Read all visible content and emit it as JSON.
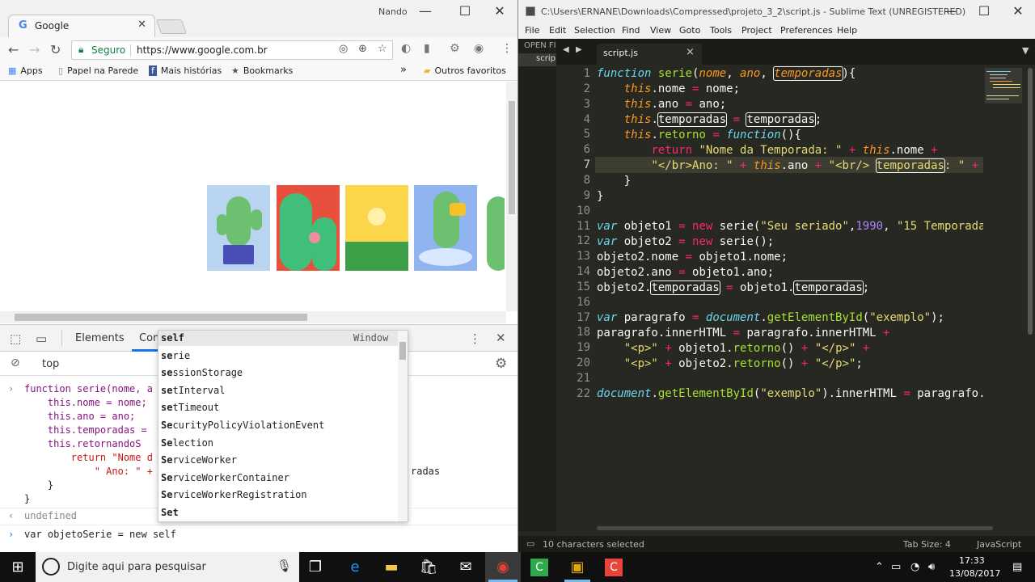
{
  "chrome": {
    "tab_title": "Google",
    "tab_close": "✕",
    "user_name": "Nando",
    "omnibox": {
      "secure_label": "Seguro",
      "url": "https://www.google.com.br"
    },
    "bookmarks": [
      {
        "label": "Apps",
        "icon": "apps-grid-icon"
      },
      {
        "label": "Papel na Parede",
        "icon": "page-icon"
      },
      {
        "label": "Mais histórias",
        "icon": "facebook-icon"
      },
      {
        "label": "Bookmarks",
        "icon": "star-icon"
      }
    ],
    "bookmarks_more": "»",
    "other_bookmarks": "Outros favoritos",
    "devtools": {
      "tab_elements": "Elements",
      "tab_console": "Console",
      "context": "top",
      "console_lines": [
        "function serie(nome, a",
        "    this.nome = nome;",
        "    this.ano = ano;",
        "    this.temporadas =",
        "    this.retornandoS",
        "        return \"Nome d",
        "            \" Ano: \" +",
        "    }",
        "}"
      ],
      "console_tail_text": "radas",
      "undefined_text": "undefined",
      "input_line": "var objetoSerie = new self",
      "autocomplete_window_label": "Window",
      "autocomplete": [
        {
          "bold": "self",
          "rest": ""
        },
        {
          "bold": "se",
          "rest": "rie"
        },
        {
          "bold": "se",
          "rest": "ssionStorage"
        },
        {
          "bold": "se",
          "rest": "tInterval"
        },
        {
          "bold": "se",
          "rest": "tTimeout"
        },
        {
          "bold": "Se",
          "rest": "curityPolicyViolationEvent"
        },
        {
          "bold": "Se",
          "rest": "lection"
        },
        {
          "bold": "Se",
          "rest": "rviceWorker"
        },
        {
          "bold": "Se",
          "rest": "rviceWorkerContainer"
        },
        {
          "bold": "Se",
          "rest": "rviceWorkerRegistration"
        },
        {
          "bold": "Set",
          "rest": ""
        }
      ]
    }
  },
  "sublime": {
    "title": "C:\\Users\\ERNANE\\Downloads\\Compressed\\projeto_3_2\\script.js - Sublime Text (UNREGISTERED)",
    "menu": [
      "File",
      "Edit",
      "Selection",
      "Find",
      "View",
      "Goto",
      "Tools",
      "Project",
      "Preferences",
      "Help"
    ],
    "sidebar_label": "OPEN FI",
    "sidebar_file": "scrip",
    "tab_name": "script.js",
    "tab_close": "×",
    "line_numbers": [
      "1",
      "2",
      "3",
      "4",
      "5",
      "6",
      "7",
      "8",
      "9",
      "10",
      "11",
      "12",
      "13",
      "14",
      "15",
      "16",
      "17",
      "18",
      "19",
      "20",
      "21",
      "22"
    ],
    "status_selection": "10 characters selected",
    "status_tab_size": "Tab Size: 4",
    "status_syntax": "JavaScript"
  },
  "taskbar": {
    "search_placeholder": "Digite aqui para pesquisar",
    "time": "17:33",
    "date": "13/08/2017"
  },
  "colors": {
    "sublime_bg": "#272822",
    "keyword": "#66d9ef",
    "string": "#e6db74",
    "function": "#a6e22e",
    "param": "#fd971f",
    "operator": "#f92672",
    "number": "#ae81ff"
  }
}
